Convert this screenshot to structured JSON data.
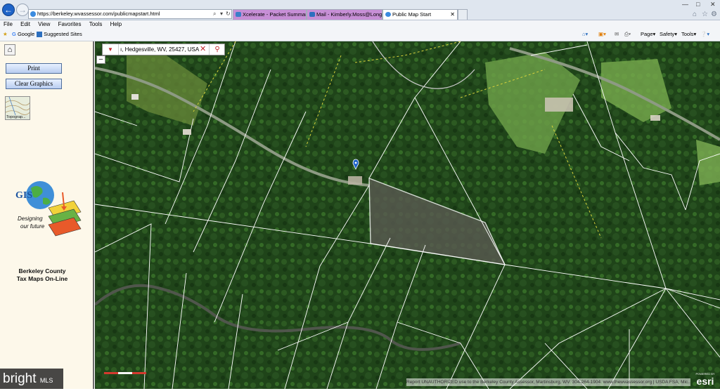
{
  "browser": {
    "url": "https://berkeley.wvassessor.com/publicmapstart.html",
    "tabs": [
      {
        "label": "Xcelerate - Packet Summary",
        "icon": "xcelerate-icon"
      },
      {
        "label": "Mail - Kimberly.Moss@Longan...",
        "icon": "mail-icon"
      },
      {
        "label": "Public Map Start",
        "icon": "ie-page-icon"
      }
    ],
    "menu": [
      "File",
      "Edit",
      "View",
      "Favorites",
      "Tools",
      "Help"
    ],
    "favorites": [
      {
        "label": "Google",
        "icon": "google-icon"
      },
      {
        "label": "Suggested Sites",
        "icon": "suggested-sites-icon"
      }
    ],
    "commands": [
      "Page",
      "Safety",
      "Tools"
    ]
  },
  "panel": {
    "print_label": "Print",
    "clear_label": "Clear Graphics",
    "topo_label": "Topograp...",
    "logo_text": "GIS",
    "logo_tagline_1": "Designing",
    "logo_tagline_2": "our future",
    "title_line1": "Berkeley County",
    "title_line2": "Tax Maps On-Line"
  },
  "map": {
    "search_value": "ı, Hedgesville, WV, 25427, USA",
    "zoom_minus": "–",
    "attribution": "Report UNAUTHORIZED use to the Berkeley County Assessor, Martinsburg, WV. 304-264-1904. www.thewvassessor.org | USDA FSA, Mic...",
    "esri_powered": "POWERED BY",
    "esri_name": "esri"
  },
  "watermark": {
    "brand": "bright",
    "suffix": "MLS"
  },
  "colors": {
    "parcel_line": "#ffffff",
    "selected_parcel": "#5a5a52",
    "dashed_line": "#d8d23c",
    "panel_bg": "#fdf8ea",
    "accent_red": "#c0272d"
  }
}
